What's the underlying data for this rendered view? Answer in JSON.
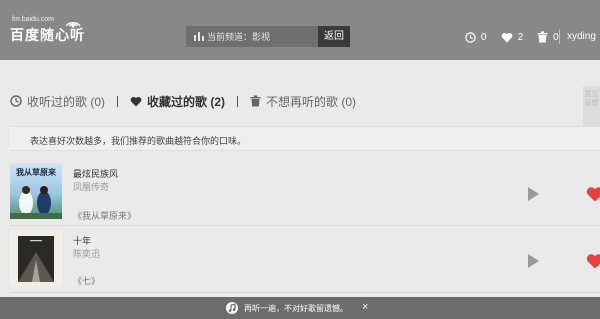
{
  "header": {
    "logo_url": "fm.baidu.com",
    "logo_text": "百度随心听",
    "channel_label": "当前频道：影视",
    "back_label": "返回",
    "history_count": "0",
    "favorite_count": "2",
    "trash_count": "0",
    "username": "xyding"
  },
  "tabs": [
    {
      "label": "收听过的歌 (0)",
      "icon": "clock-icon"
    },
    {
      "label": "收藏过的歌 (2)",
      "icon": "heart-icon"
    },
    {
      "label": "不想再听的歌 (0)",
      "icon": "trash-icon"
    }
  ],
  "side_tab": {
    "label": "意见反馈"
  },
  "info": {
    "text": "表达喜好次数越多，我们推荐的歌曲越符合你的口味。"
  },
  "songs": [
    {
      "title": "最炫民族风",
      "artist": "凤凰传奇",
      "album": "《我从草原来》",
      "cover_text": "我从草原来"
    },
    {
      "title": "十年",
      "artist": "陈奕迅",
      "album": "《七》",
      "cover_text": ""
    }
  ],
  "toast": {
    "text": "再听一遍，不对好歌留遗憾。",
    "close": "×"
  },
  "colors": {
    "header_bg": "#888888",
    "channel_bg": "#6f6f6f",
    "back_bg": "#3a3a3a",
    "fav_red": "#e8403f",
    "toast_bg": "#6c6c6c"
  }
}
